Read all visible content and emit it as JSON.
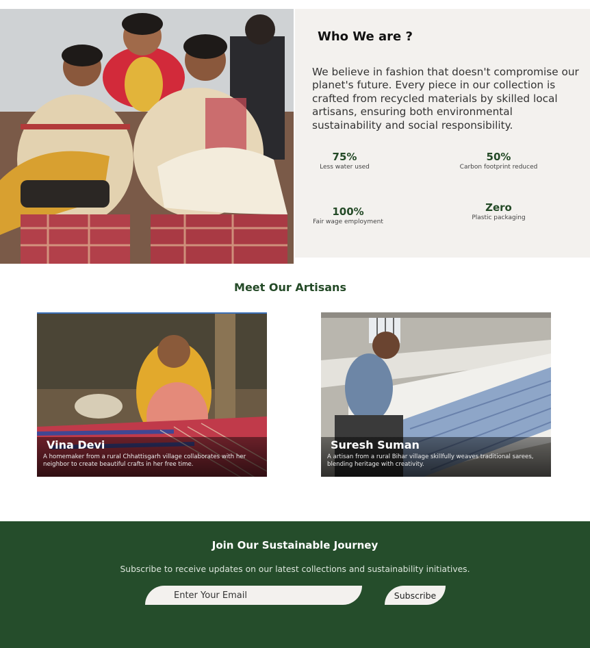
{
  "about": {
    "title": "Who We are ?",
    "text": "We believe in fashion that doesn't compromise our planet's future. Every piece in our collection is crafted from recycled materials by skilled local artisans, ensuring both environmental sustainability and social responsibility.",
    "stats": [
      {
        "value": "75%",
        "label": "Less water used"
      },
      {
        "value": "50%",
        "label": "Carbon footprint reduced"
      },
      {
        "value": "100%",
        "label": "Fair wage employment"
      },
      {
        "value": "Zero",
        "label": "Plastic packaging"
      }
    ]
  },
  "artisans": {
    "title": "Meet Our Artisans",
    "cards": [
      {
        "name": "Vina Devi",
        "description": "A homemaker from a rural Chhattisgarh village collaborates with her neighbor to create beautiful crafts in her free time."
      },
      {
        "name": "Suresh Suman",
        "description": "A artisan from a rural Bihar village skillfully weaves traditional sarees, blending heritage with creativity."
      }
    ]
  },
  "newsletter": {
    "title": "Join Our Sustainable Journey",
    "subtitle": "Subscribe to receive updates on our latest collections and sustainability initiatives.",
    "email_placeholder": "Enter Your Email",
    "button_label": "Subscribe"
  },
  "colors": {
    "brand_green": "#254d2b",
    "panel_beige": "#f3f1ee"
  }
}
